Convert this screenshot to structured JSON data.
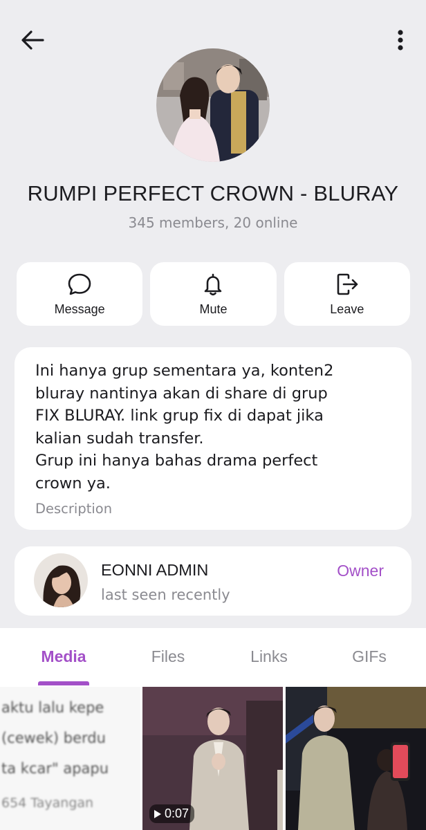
{
  "header": {
    "back_icon": "arrow-left-icon",
    "menu_icon": "more-vertical-icon"
  },
  "group": {
    "title": "RUMPI PERFECT CROWN - BLURAY",
    "subtitle": "345 members, 20 online"
  },
  "actions": [
    {
      "label": "Message",
      "icon": "chat-bubble-icon"
    },
    {
      "label": "Mute",
      "icon": "bell-icon"
    },
    {
      "label": "Leave",
      "icon": "leave-icon"
    }
  ],
  "description": {
    "text": "Ini hanya grup sementara ya, konten2\nbluray nantinya akan di share di grup\nFIX BLURAY. link grup fix di dapat jika\nkalian sudah transfer.\nGrup ini hanya bahas drama perfect\ncrown ya.",
    "label": "Description"
  },
  "owner": {
    "name": "EONNI ADMIN",
    "status": "last seen recently",
    "role": "Owner"
  },
  "tabs": [
    {
      "label": "Media",
      "active": true
    },
    {
      "label": "Files",
      "active": false
    },
    {
      "label": "Links",
      "active": false
    },
    {
      "label": "GIFs",
      "active": false
    }
  ],
  "media": {
    "item1_lines": [
      "aktu lalu kepe",
      "(cewek) berdu",
      "ta kcar\" apapu",
      "654 Tayangan"
    ],
    "video_duration": "0:07"
  },
  "colors": {
    "accent": "#a350c8",
    "background": "#ededf0",
    "card": "#ffffff",
    "muted_text": "#8a8a90"
  }
}
